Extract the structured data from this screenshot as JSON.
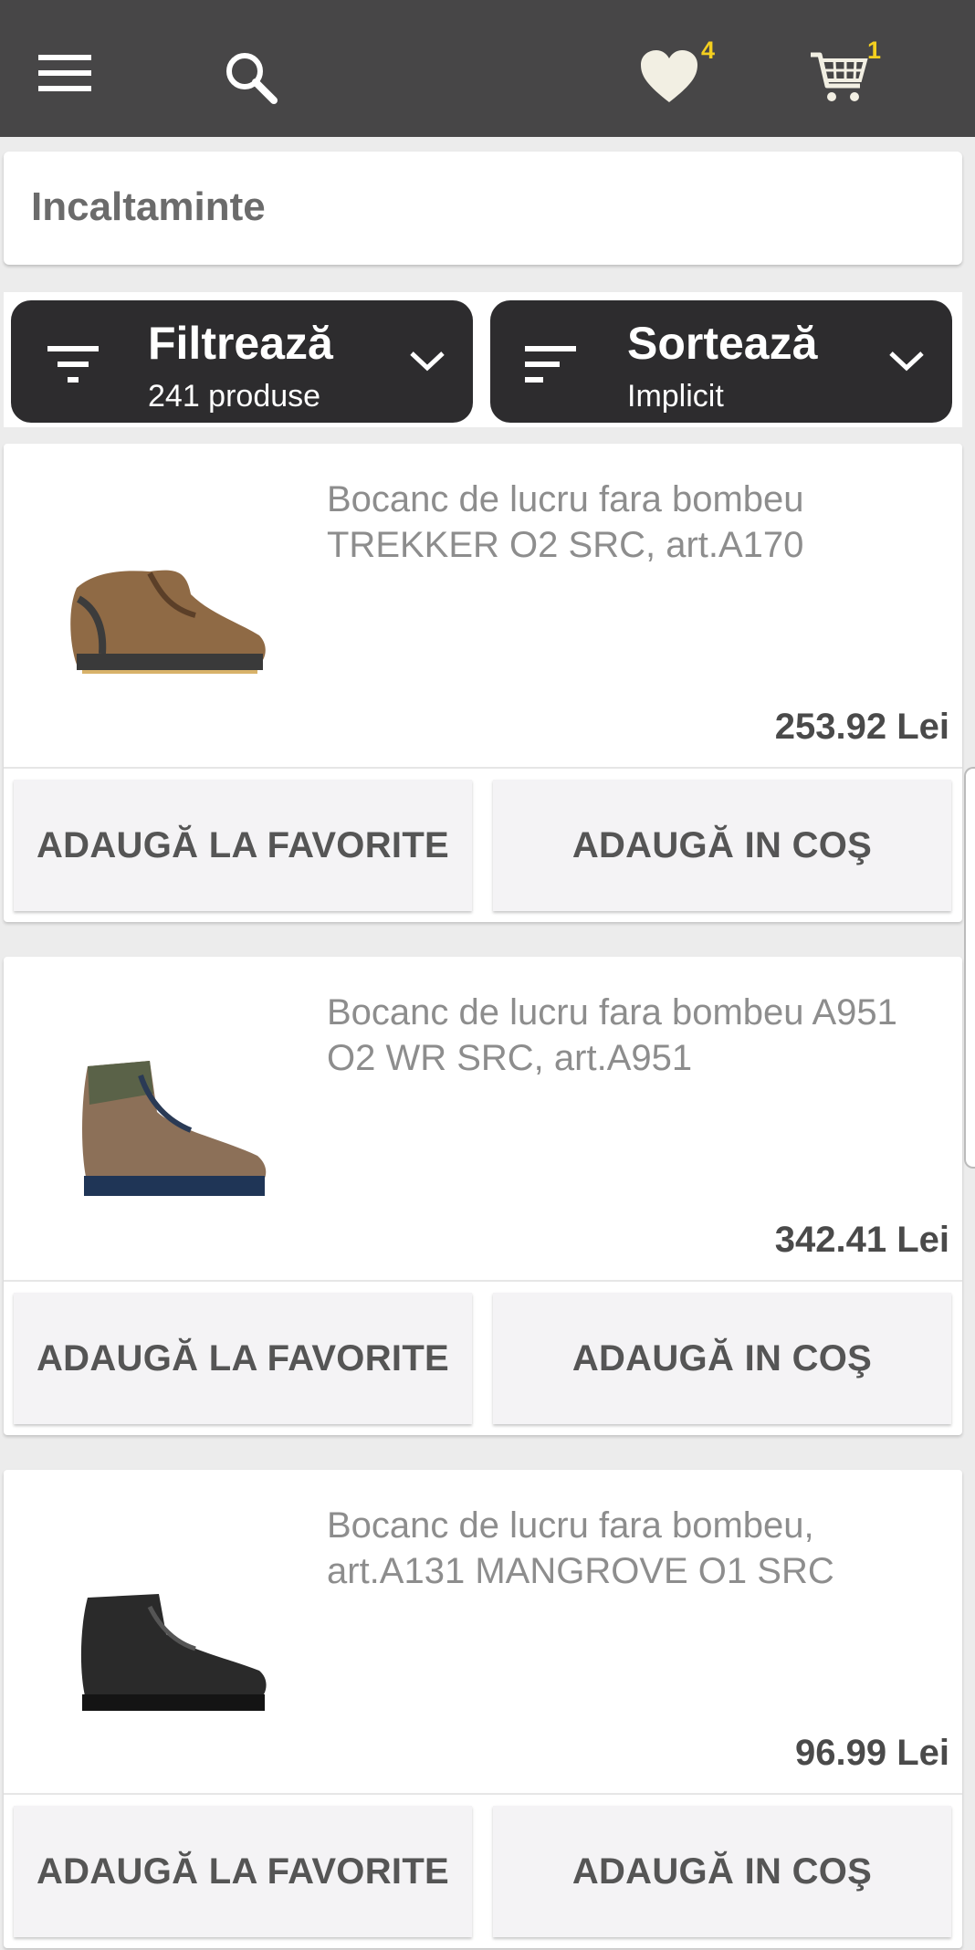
{
  "header": {
    "favorites_count": "4",
    "cart_count": "1",
    "icons": [
      "menu-icon",
      "search-icon",
      "heart-icon",
      "cart-icon"
    ],
    "colors": {
      "bar": "#474647",
      "badge": "#f4cf1f"
    }
  },
  "category": {
    "title": "Incaltaminte"
  },
  "filter": {
    "title": "Filtrează",
    "subtitle": "241 produse"
  },
  "sort": {
    "title": "Sortează",
    "subtitle": "Implicit"
  },
  "products": [
    {
      "name": "Bocanc de lucru fara bombeu TREKKER O2 SRC, art.A170",
      "price": "253.92 Lei",
      "fav_label": "ADAUGĂ LA FAVORITE",
      "cart_label": "ADAUGĂ IN COŞ",
      "image": "brown-work-boot"
    },
    {
      "name": "Bocanc de lucru fara bombeu A951 O2 WR SRC, art.A951",
      "price": "342.41 Lei",
      "fav_label": "ADAUGĂ LA FAVORITE",
      "cart_label": "ADAUGĂ IN COŞ",
      "image": "brown-green-hiking-boot"
    },
    {
      "name": "Bocanc de lucru fara bombeu, art.A131 MANGROVE O1 SRC",
      "price": "96.99 Lei",
      "fav_label": "ADAUGĂ LA FAVORITE",
      "cart_label": "ADAUGĂ IN COŞ",
      "image": "black-work-boot"
    }
  ]
}
